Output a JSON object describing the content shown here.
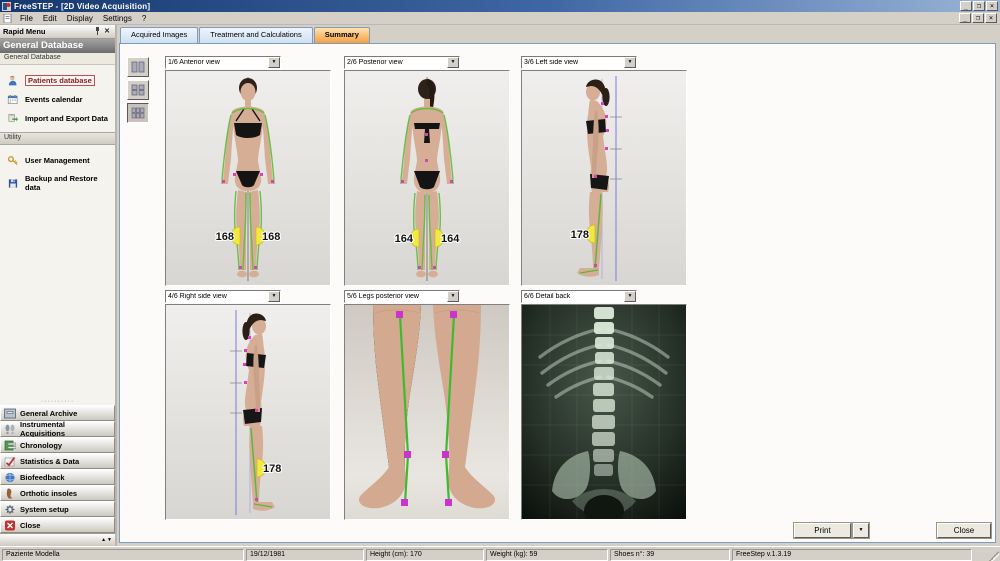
{
  "window": {
    "title": "FreeSTEP - [2D Video Acquisition]",
    "menu": [
      "File",
      "Edit",
      "Display",
      "Settings",
      "?"
    ]
  },
  "sidebar": {
    "header": "Rapid Menu",
    "section_title": "General Database",
    "section_subtitle": "General Database",
    "items": [
      {
        "label": "Patients database",
        "selected": true
      },
      {
        "label": "Events calendar",
        "selected": false
      },
      {
        "label": "Import and Export Data",
        "selected": false
      }
    ],
    "utility_header": "Utility",
    "utility_items": [
      {
        "label": "User Management"
      },
      {
        "label": "Backup and Restore data"
      }
    ],
    "accordion": [
      "General Archive",
      "Instrumental Acquisitions",
      "Chronology",
      "Statistics & Data",
      "Biofeedback",
      "Orthotic insoles",
      "System setup",
      "Close"
    ]
  },
  "tabs": [
    {
      "label": "Acquired Images",
      "active": false
    },
    {
      "label": "Treatment and Calculations",
      "active": false
    },
    {
      "label": "Summary",
      "active": true
    }
  ],
  "panels": [
    {
      "view": "1/6 Anterior view",
      "angles": [
        "168",
        "168"
      ]
    },
    {
      "view": "2/6 Posterior view",
      "angles": [
        "164",
        "164"
      ]
    },
    {
      "view": "3/6 Left side view",
      "angles": [
        "178"
      ]
    },
    {
      "view": "4/6 Right side view",
      "angles": [
        "178"
      ]
    },
    {
      "view": "5/6 Legs posterior view",
      "angles": []
    },
    {
      "view": "6/6 Detail back",
      "angles": []
    }
  ],
  "footer_buttons": {
    "print": "Print",
    "close": "Close"
  },
  "statusbar": [
    "Paziente Modella",
    "19/12/1981",
    "Height (cm): 170",
    "Weight (kg): 59",
    "Shoes n°: 39",
    "FreeStep v.1.3.19"
  ],
  "colors": {
    "active_tab_orange": "#f4a042",
    "overlay_green": "#5cbe3a",
    "marker_magenta": "#d643b9",
    "angle_yellow": "#f2e93e",
    "titlebar_blue": "#16386e",
    "selected_item_red": "#7e1f1f"
  }
}
